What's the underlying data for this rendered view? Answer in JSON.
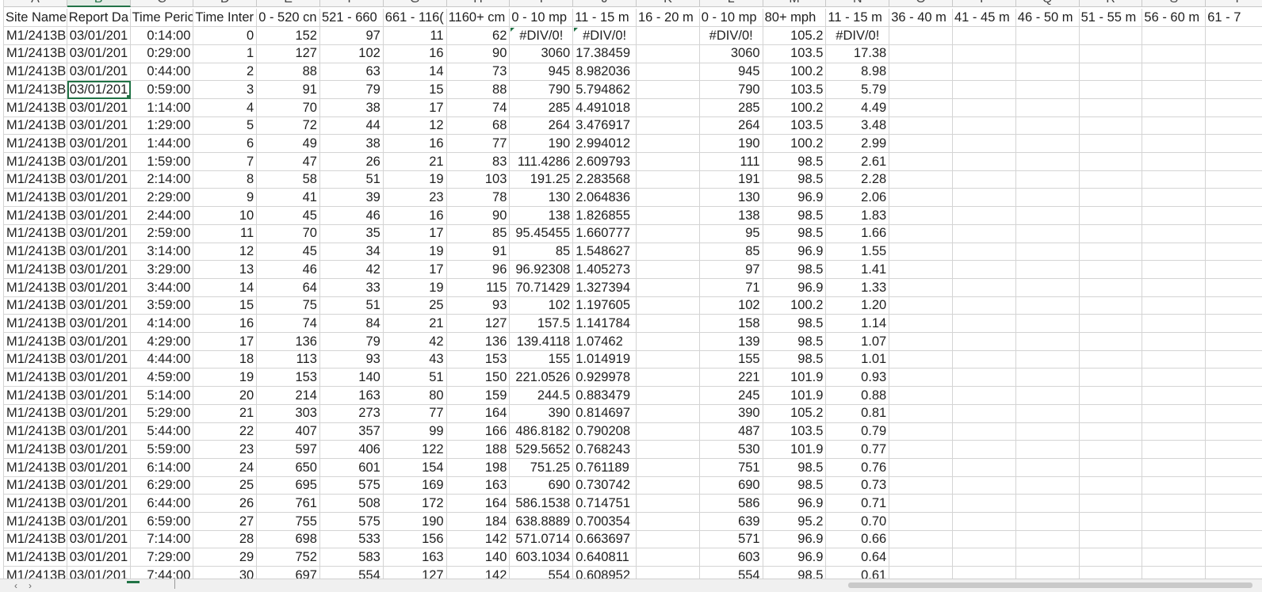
{
  "column_letters": [
    "A",
    "B",
    "C",
    "D",
    "E",
    "F",
    "G",
    "H",
    "I",
    "J",
    "K",
    "L",
    "M",
    "N",
    "O",
    "P",
    "Q",
    "R",
    "S",
    "T"
  ],
  "header_row": [
    "Site Name",
    "Report Da",
    "Time Perio",
    "Time Inter",
    "0 - 520 cn",
    "521 - 660",
    "661 - 116(",
    "1160+ cm",
    "0 - 10 mp",
    "11 - 15 m",
    "16 - 20 m",
    "0 - 10 mp",
    "80+ mph",
    "11 - 15 m",
    "36 - 40 m",
    "41 - 45 m",
    "46 - 50 m",
    "51 - 55 m",
    "56 - 60 m",
    "61 - 7"
  ],
  "rows": [
    [
      "M1/2413B",
      "03/01/201",
      "0:14:00",
      "0",
      "152",
      "97",
      "11",
      "62",
      "#DIV/0!",
      "#DIV/0!",
      "",
      "#DIV/0!",
      "105.2",
      "#DIV/0!"
    ],
    [
      "M1/2413B",
      "03/01/201",
      "0:29:00",
      "1",
      "127",
      "102",
      "16",
      "90",
      "3060",
      "17.38459",
      "",
      "3060",
      "103.5",
      "17.38"
    ],
    [
      "M1/2413B",
      "03/01/201",
      "0:44:00",
      "2",
      "88",
      "63",
      "14",
      "73",
      "945",
      "8.982036",
      "",
      "945",
      "100.2",
      "8.98"
    ],
    [
      "M1/2413B",
      "03/01/201",
      "0:59:00",
      "3",
      "91",
      "79",
      "15",
      "88",
      "790",
      "5.794862",
      "",
      "790",
      "103.5",
      "5.79"
    ],
    [
      "M1/2413B",
      "03/01/201",
      "1:14:00",
      "4",
      "70",
      "38",
      "17",
      "74",
      "285",
      "4.491018",
      "",
      "285",
      "100.2",
      "4.49"
    ],
    [
      "M1/2413B",
      "03/01/201",
      "1:29:00",
      "5",
      "72",
      "44",
      "12",
      "68",
      "264",
      "3.476917",
      "",
      "264",
      "103.5",
      "3.48"
    ],
    [
      "M1/2413B",
      "03/01/201",
      "1:44:00",
      "6",
      "49",
      "38",
      "16",
      "77",
      "190",
      "2.994012",
      "",
      "190",
      "100.2",
      "2.99"
    ],
    [
      "M1/2413B",
      "03/01/201",
      "1:59:00",
      "7",
      "47",
      "26",
      "21",
      "83",
      "111.4286",
      "2.609793",
      "",
      "111",
      "98.5",
      "2.61"
    ],
    [
      "M1/2413B",
      "03/01/201",
      "2:14:00",
      "8",
      "58",
      "51",
      "19",
      "103",
      "191.25",
      "2.283568",
      "",
      "191",
      "98.5",
      "2.28"
    ],
    [
      "M1/2413B",
      "03/01/201",
      "2:29:00",
      "9",
      "41",
      "39",
      "23",
      "78",
      "130",
      "2.064836",
      "",
      "130",
      "96.9",
      "2.06"
    ],
    [
      "M1/2413B",
      "03/01/201",
      "2:44:00",
      "10",
      "45",
      "46",
      "16",
      "90",
      "138",
      "1.826855",
      "",
      "138",
      "98.5",
      "1.83"
    ],
    [
      "M1/2413B",
      "03/01/201",
      "2:59:00",
      "11",
      "70",
      "35",
      "17",
      "85",
      "95.45455",
      "1.660777",
      "",
      "95",
      "98.5",
      "1.66"
    ],
    [
      "M1/2413B",
      "03/01/201",
      "3:14:00",
      "12",
      "45",
      "34",
      "19",
      "91",
      "85",
      "1.548627",
      "",
      "85",
      "96.9",
      "1.55"
    ],
    [
      "M1/2413B",
      "03/01/201",
      "3:29:00",
      "13",
      "46",
      "42",
      "17",
      "96",
      "96.92308",
      "1.405273",
      "",
      "97",
      "98.5",
      "1.41"
    ],
    [
      "M1/2413B",
      "03/01/201",
      "3:44:00",
      "14",
      "64",
      "33",
      "19",
      "115",
      "70.71429",
      "1.327394",
      "",
      "71",
      "96.9",
      "1.33"
    ],
    [
      "M1/2413B",
      "03/01/201",
      "3:59:00",
      "15",
      "75",
      "51",
      "25",
      "93",
      "102",
      "1.197605",
      "",
      "102",
      "100.2",
      "1.20"
    ],
    [
      "M1/2413B",
      "03/01/201",
      "4:14:00",
      "16",
      "74",
      "84",
      "21",
      "127",
      "157.5",
      "1.141784",
      "",
      "158",
      "98.5",
      "1.14"
    ],
    [
      "M1/2413B",
      "03/01/201",
      "4:29:00",
      "17",
      "136",
      "79",
      "42",
      "136",
      "139.4118",
      "1.07462",
      "",
      "139",
      "98.5",
      "1.07"
    ],
    [
      "M1/2413B",
      "03/01/201",
      "4:44:00",
      "18",
      "113",
      "93",
      "43",
      "153",
      "155",
      "1.014919",
      "",
      "155",
      "98.5",
      "1.01"
    ],
    [
      "M1/2413B",
      "03/01/201",
      "4:59:00",
      "19",
      "153",
      "140",
      "51",
      "150",
      "221.0526",
      "0.929978",
      "",
      "221",
      "101.9",
      "0.93"
    ],
    [
      "M1/2413B",
      "03/01/201",
      "5:14:00",
      "20",
      "214",
      "163",
      "80",
      "159",
      "244.5",
      "0.883479",
      "",
      "245",
      "101.9",
      "0.88"
    ],
    [
      "M1/2413B",
      "03/01/201",
      "5:29:00",
      "21",
      "303",
      "273",
      "77",
      "164",
      "390",
      "0.814697",
      "",
      "390",
      "105.2",
      "0.81"
    ],
    [
      "M1/2413B",
      "03/01/201",
      "5:44:00",
      "22",
      "407",
      "357",
      "99",
      "166",
      "486.8182",
      "0.790208",
      "",
      "487",
      "103.5",
      "0.79"
    ],
    [
      "M1/2413B",
      "03/01/201",
      "5:59:00",
      "23",
      "597",
      "406",
      "122",
      "188",
      "529.5652",
      "0.768243",
      "",
      "530",
      "101.9",
      "0.77"
    ],
    [
      "M1/2413B",
      "03/01/201",
      "6:14:00",
      "24",
      "650",
      "601",
      "154",
      "198",
      "751.25",
      "0.761189",
      "",
      "751",
      "98.5",
      "0.76"
    ],
    [
      "M1/2413B",
      "03/01/201",
      "6:29:00",
      "25",
      "695",
      "575",
      "169",
      "163",
      "690",
      "0.730742",
      "",
      "690",
      "98.5",
      "0.73"
    ],
    [
      "M1/2413B",
      "03/01/201",
      "6:44:00",
      "26",
      "761",
      "508",
      "172",
      "164",
      "586.1538",
      "0.714751",
      "",
      "586",
      "96.9",
      "0.71"
    ],
    [
      "M1/2413B",
      "03/01/201",
      "6:59:00",
      "27",
      "755",
      "575",
      "190",
      "184",
      "638.8889",
      "0.700354",
      "",
      "639",
      "95.2",
      "0.70"
    ],
    [
      "M1/2413B",
      "03/01/201",
      "7:14:00",
      "28",
      "698",
      "533",
      "156",
      "142",
      "571.0714",
      "0.663697",
      "",
      "571",
      "96.9",
      "0.66"
    ],
    [
      "M1/2413B",
      "03/01/201",
      "7:29:00",
      "29",
      "752",
      "583",
      "163",
      "140",
      "603.1034",
      "0.640811",
      "",
      "603",
      "96.9",
      "0.64"
    ],
    [
      "M1/2413B",
      "03/01/201",
      "7:44:00",
      "30",
      "697",
      "554",
      "127",
      "142",
      "554",
      "0.608952",
      "",
      "554",
      "98.5",
      "0.61"
    ]
  ],
  "selected_column": "B",
  "active_cell_text": "03/01/201",
  "accent_color": "#217346",
  "gridline_color": "#d4d4d4"
}
